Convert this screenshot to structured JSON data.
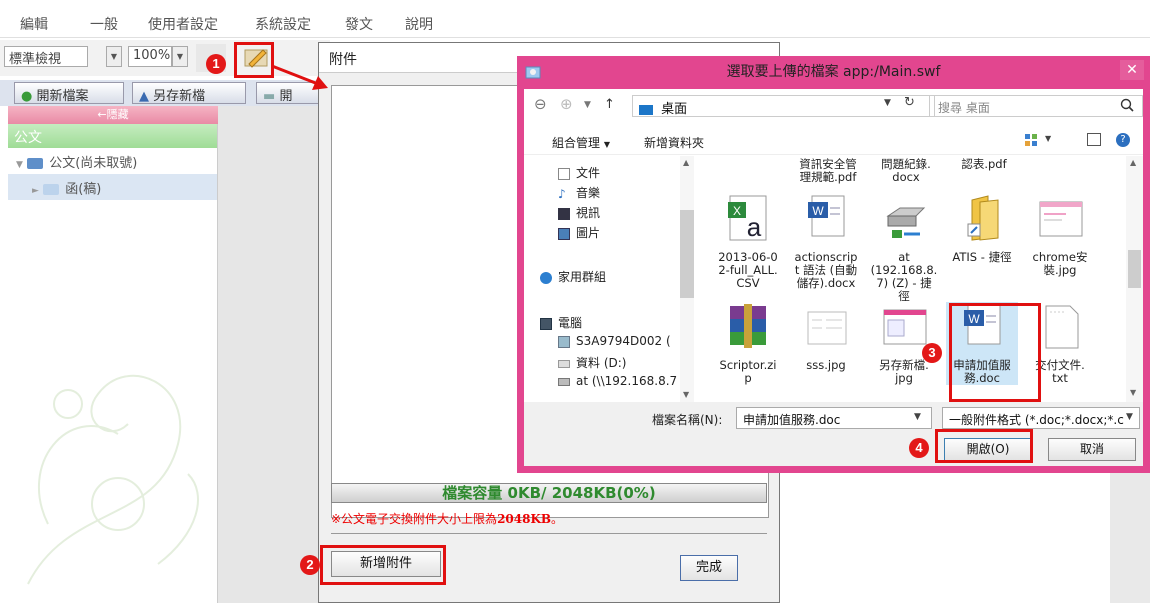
{
  "menu": [
    "編輯",
    "一般",
    "使用者設定",
    "系統設定",
    "發文",
    "說明"
  ],
  "toolbar": {
    "view_select": "標準檢視",
    "zoom_select": "100%",
    "new_file_button": "開新檔案",
    "save_as_button": "另存新檔",
    "open_button_partial": "開"
  },
  "left_panel": {
    "collapse_label": "←隱藏",
    "header": "公文",
    "tree": [
      {
        "label": "公文(尚未取號)"
      },
      {
        "label": "函(稿)"
      }
    ]
  },
  "attach_dialog": {
    "title": "附件",
    "capacity": "檔案容量 0KB/ 2048KB(0%)",
    "limit_note_prefix": "※公文電子交換附件大小上限為",
    "limit_note_value": "2048KB",
    "limit_note_suffix": "。",
    "add_button": "新增附件",
    "done_button": "完成"
  },
  "file_dialog": {
    "title": "選取要上傳的檔案 app:/Main.swf",
    "address": "桌面",
    "search_placeholder": "搜尋 桌面",
    "organize": "組合管理",
    "new_folder": "新增資料夾",
    "nav_items": [
      {
        "label": "文件",
        "icon": "document-icon"
      },
      {
        "label": "音樂",
        "icon": "music-icon"
      },
      {
        "label": "視訊",
        "icon": "video-icon"
      },
      {
        "label": "圖片",
        "icon": "picture-icon"
      },
      {
        "label": "家用群組",
        "icon": "homegroup-icon"
      },
      {
        "label": "電腦",
        "icon": "computer-icon"
      },
      {
        "label": "S3A9794D002 (",
        "icon": "drive-icon"
      },
      {
        "label": "資料 (D:)",
        "icon": "disk-icon"
      },
      {
        "label": "at (\\\\192.168.8.7",
        "icon": "network-drive-icon"
      }
    ],
    "files_top_partial": [
      {
        "label": "資訊安全管\n理規範.pdf"
      },
      {
        "label": "問題紀錄.\ndocx"
      },
      {
        "label": "認表.pdf"
      }
    ],
    "files": [
      {
        "label": "2013-06-0\n2-full_ALL.\nCSV",
        "icon": "excel-icon"
      },
      {
        "label": "actionscrip\nt 語法 (自動\n儲存).docx",
        "icon": "word-icon"
      },
      {
        "label": "at\n(192.168.8.\n7) (Z) - 捷\n徑",
        "icon": "network-drive-shortcut-icon"
      },
      {
        "label": "ATIS - 捷徑",
        "icon": "folder-shortcut-icon"
      },
      {
        "label": "chrome安\n裝.jpg",
        "icon": "image-icon"
      },
      {
        "label": "Scriptor.zi\np",
        "icon": "winrar-icon"
      },
      {
        "label": "sss.jpg",
        "icon": "image-icon"
      },
      {
        "label": "另存新檔.\njpg",
        "icon": "image-icon"
      },
      {
        "label": "申請加值服\n務.doc",
        "icon": "word-icon",
        "selected": true
      },
      {
        "label": "交付文件.\ntxt",
        "icon": "text-file-icon"
      }
    ],
    "filename_label": "檔案名稱(N):",
    "filename_value": "申請加值服務.doc",
    "filetype_value": "一般附件格式 (*.doc;*.docx;*.c",
    "open_button": "開啟(O)",
    "cancel_button": "取消"
  },
  "annotations": [
    "1",
    "2",
    "3",
    "4"
  ],
  "colors": {
    "dialog_frame": "#e2468f",
    "annotation_red": "#e01010",
    "capacity_green": "#2f8a2f",
    "limit_red": "#ee0000"
  }
}
